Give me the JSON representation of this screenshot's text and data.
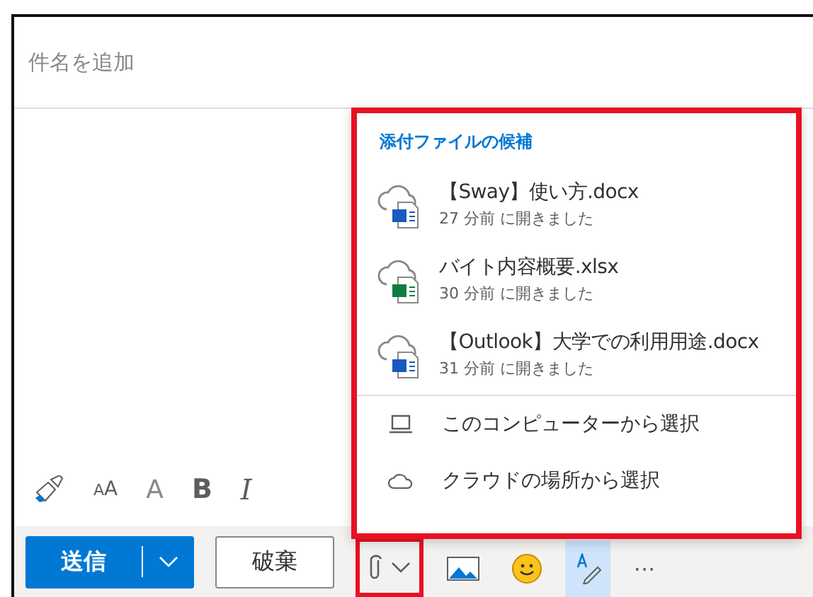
{
  "subject": {
    "placeholder": "件名を追加"
  },
  "format_tools": [
    {
      "kind": "brush"
    },
    {
      "kind": "font_size",
      "parts": [
        "A",
        "A"
      ]
    },
    {
      "kind": "grow",
      "label": "A"
    },
    {
      "kind": "bold",
      "label": "B"
    },
    {
      "kind": "italic",
      "label": "I"
    }
  ],
  "attach_popup": {
    "highlighted": true,
    "heading": "添付ファイルの候補",
    "files": [
      {
        "name": "【Sway】使い方.docx",
        "opened": "27 分前 に開きました",
        "kind": "word"
      },
      {
        "name": "バイト内容概要.xlsx",
        "opened": "30 分前 に開きました",
        "kind": "excel"
      },
      {
        "name": "【Outlook】大学での利用用途.docx",
        "opened": "31 分前 に開きました",
        "kind": "word"
      }
    ],
    "options": [
      {
        "kind": "computer",
        "label": "このコンピューターから選択"
      },
      {
        "kind": "cloud",
        "label": "クラウドの場所から選択"
      }
    ]
  },
  "actions": {
    "send": "送信",
    "discard": "破棄"
  },
  "bottom_tools": [
    {
      "kind": "attach",
      "highlighted": true,
      "selected": false
    },
    {
      "kind": "image",
      "selected": false
    },
    {
      "kind": "emoji",
      "selected": false
    },
    {
      "kind": "draw",
      "selected": true
    },
    {
      "kind": "more",
      "label": "···",
      "selected": false
    }
  ]
}
